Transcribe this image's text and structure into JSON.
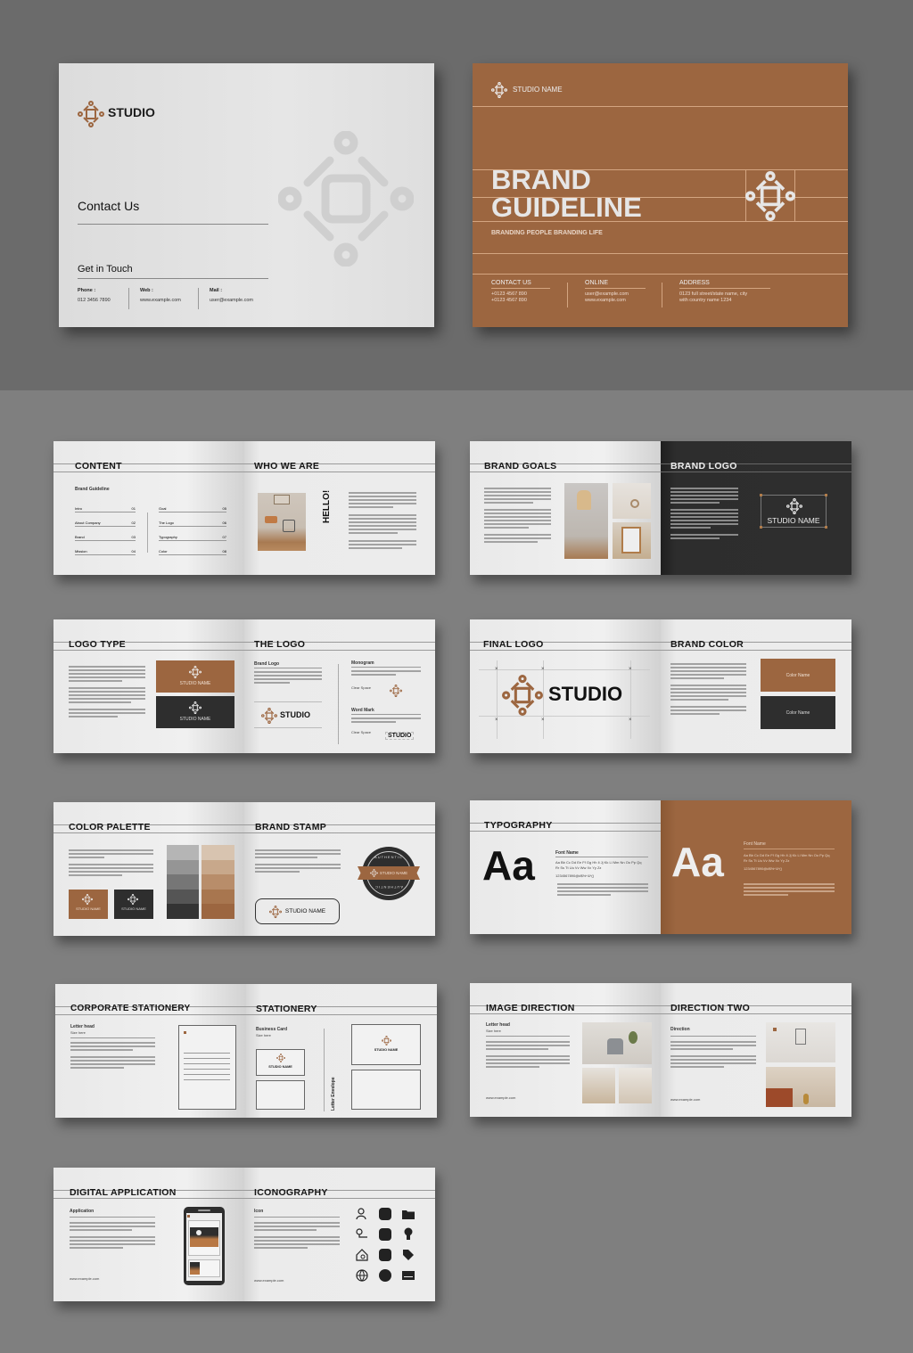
{
  "colors": {
    "brand_brown": "#9c6640",
    "dark": "#2e2e2e",
    "light_page": "#ececec",
    "bg_top": "#6b6b6b",
    "bg_bottom": "#7f7f7f"
  },
  "back_cover": {
    "logo_text": "STUDIO",
    "heading": "Contact Us",
    "subheading": "Get in Touch",
    "contacts": [
      {
        "label": "Phone :",
        "value": "012 3456 7890"
      },
      {
        "label": "Web :",
        "value": "www.example.com"
      },
      {
        "label": "Mail :",
        "value": "user@example.com"
      }
    ]
  },
  "front_cover": {
    "studio_name": "STUDIO NAME",
    "title_line1": "BRAND",
    "title_line2": "GUIDELINE",
    "tagline": "BRANDING PEOPLE BRANDING LIFE",
    "columns": [
      {
        "heading": "CONTACT US",
        "line1": "+0123 4567 890",
        "line2": "+0123 4567 890"
      },
      {
        "heading": "ONLINE",
        "line1": "user@example.com",
        "line2": "www.example.com"
      },
      {
        "heading": "ADDRESS",
        "line1": "0123 full street/state name, city",
        "line2": "with country name 1234"
      }
    ]
  },
  "spreads": [
    {
      "left": "CONTENT",
      "right": "WHO WE ARE"
    },
    {
      "left": "BRAND GOALS",
      "right": "BRAND LOGO"
    },
    {
      "left": "LOGO TYPE",
      "right": "THE LOGO"
    },
    {
      "left": "FINAL LOGO",
      "right": "BRAND COLOR"
    },
    {
      "left": "COLOR PALETTE",
      "right": "BRAND STAMP"
    },
    {
      "left": "TYPOGRAPHY",
      "right": ""
    },
    {
      "left": "CORPORATE STATIONERY",
      "right": "STATIONERY"
    },
    {
      "left": "IMAGE DIRECTION",
      "right": "DIRECTION TWO"
    },
    {
      "left": "DIGITAL APPLICATION",
      "right": "ICONOGRAPHY"
    }
  ],
  "content_page": {
    "subtitle": "Brand Guideline",
    "toc_left": [
      {
        "label": "Intro",
        "num": "01"
      },
      {
        "label": "About Company",
        "num": "02"
      },
      {
        "label": "Brand",
        "num": "03"
      },
      {
        "label": "Mission",
        "num": "04"
      }
    ],
    "toc_right": [
      {
        "label": "Goal",
        "num": "05"
      },
      {
        "label": "The Logo",
        "num": "06"
      },
      {
        "label": "Typography",
        "num": "07"
      },
      {
        "label": "Color",
        "num": "08"
      }
    ]
  },
  "who_we_are": {
    "vertical_text": "HELLO!"
  },
  "brand_logo": {
    "name": "STUDIO NAME"
  },
  "logo_type": {
    "name1": "STUDIO NAME",
    "name2": "STUDIO NAME"
  },
  "the_logo": {
    "brand_logo_label": "Brand Logo",
    "logo_text": "STUDIO",
    "monogram_label": "Monogram",
    "wordmark_label": "Word Mark",
    "clear_space": "Clear Space",
    "wordmark_text": "STUDIO"
  },
  "final_logo": {
    "logo_text": "STUDIO"
  },
  "brand_color": {
    "swatches": [
      {
        "name": "Color Name",
        "hex": "#9c6640"
      },
      {
        "name": "Color Name",
        "hex": "#2e2e2e"
      }
    ]
  },
  "color_palette": {
    "gray_scale": [
      "#b5b5b5",
      "#959595",
      "#767676",
      "#555555",
      "#333333"
    ],
    "brown_scale": [
      "#d8c4b0",
      "#c8a88b",
      "#b88d6a",
      "#a8764f",
      "#9c6640"
    ],
    "card1": "STUDIO NAME",
    "card2": "STUDIO NAME"
  },
  "brand_stamp": {
    "pill_text": "STUDIO NAME",
    "badge_text": "STUDIO NAME",
    "badge_ring": "AUTHENTIC"
  },
  "typography": {
    "font_label": "Font Name",
    "sample": "Aa",
    "alphabet1": "Aa Bb Cc Dd Ee Ff Gg Hh Ii Jj Kk Ll Mm Nn Oo Pp Qq",
    "alphabet2": "Rr Ss Tt Uu Vv Ww Xx Yy Zz",
    "numerals": "1234567890@#$%^&*()"
  },
  "stationery": {
    "letterhead_label": "Letter head",
    "size_here": "Size here",
    "business_card_label": "Business Card",
    "envelope_label": "Letter Envelope",
    "card_name": "STUDIO NAME"
  },
  "image_direction": {
    "label": "Letter head",
    "size_here": "Size here",
    "url": "www.example.com"
  },
  "direction_two": {
    "label": "Direction",
    "url": "www.example.com"
  },
  "digital_application": {
    "label": "Application",
    "url": "www.example.com"
  },
  "iconography": {
    "label": "Icon",
    "url": "www.example.com"
  }
}
